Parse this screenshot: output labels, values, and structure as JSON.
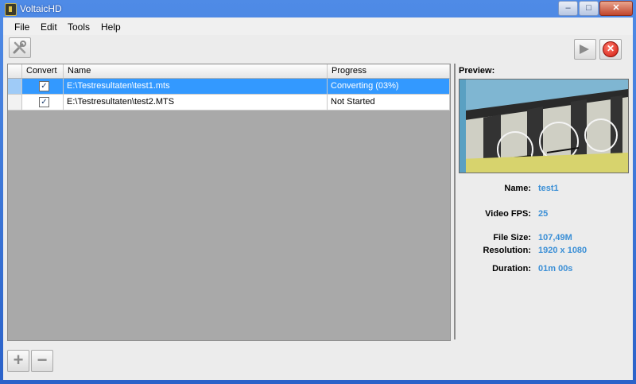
{
  "window": {
    "title": "VoltaicHD",
    "minimize_glyph": "–",
    "maximize_glyph": "□",
    "close_glyph": "✕"
  },
  "menu": {
    "file": "File",
    "edit": "Edit",
    "tools": "Tools",
    "help": "Help"
  },
  "toolbar": {
    "settings_icon": "tools-icon",
    "start_icon": "arrow-right-icon",
    "stop_icon": "stop-icon",
    "stop_glyph": "✕"
  },
  "grid": {
    "columns": [
      "Convert",
      "Name",
      "Progress"
    ],
    "rows": [
      {
        "convert": true,
        "check_glyph": "✓",
        "name": "E:\\Testresultaten\\test1.mts",
        "progress": "Converting (03%)",
        "selected": true
      },
      {
        "convert": true,
        "check_glyph": "✓",
        "name": "E:\\Testresultaten\\test2.MTS",
        "progress": "Not Started",
        "selected": false
      }
    ]
  },
  "preview": {
    "label": "Preview:",
    "fields": [
      {
        "label": "Name:",
        "value": "test1"
      },
      {
        "label": "Video FPS:",
        "value": "25"
      },
      {
        "label": "File Size:",
        "value": "107,49M"
      },
      {
        "label": "Resolution:",
        "value": "1920 x 1080"
      },
      {
        "label": "Duration:",
        "value": "01m 00s"
      }
    ]
  },
  "bottom": {
    "add_glyph": "+",
    "remove_glyph": "−"
  }
}
